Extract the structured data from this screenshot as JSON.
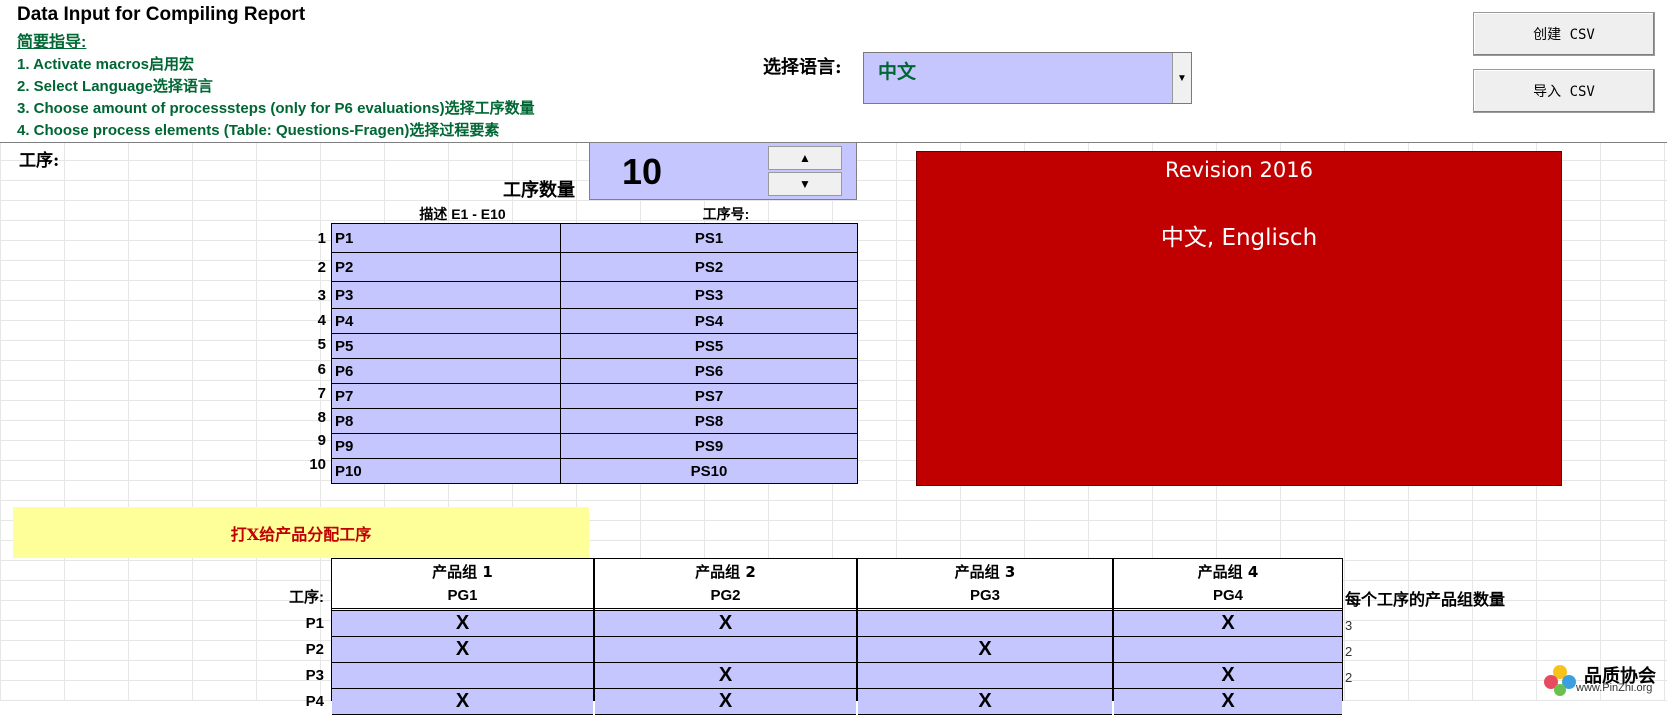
{
  "header": {
    "title": "Data Input for Compiling Report",
    "guide_link": "简要指导:",
    "steps": [
      "1. Activate macros启用宏",
      "2. Select Language选择语言",
      "3. Choose amount of processsteps (only for P6 evaluations)选择工序数量",
      "4. Choose process elements (Table: Questions-Fragen)选择过程要素"
    ]
  },
  "language": {
    "label": "选择语言:",
    "selected": "中文",
    "dropdown_arrow": "▼"
  },
  "buttons": {
    "create_csv": "创建 CSV",
    "import_csv": "导入 CSV"
  },
  "process": {
    "section_label": "工序:",
    "count_label": "工序数量",
    "count_value": "10",
    "spin_up": "▲",
    "spin_down": "▼",
    "col_desc": "描述 E1 - E10",
    "col_no": "工序号:",
    "rows": [
      {
        "num": "1",
        "desc": "P1",
        "no": "PS1"
      },
      {
        "num": "2",
        "desc": "P2",
        "no": "PS2"
      },
      {
        "num": "3",
        "desc": "P3",
        "no": "PS3"
      },
      {
        "num": "4",
        "desc": "P4",
        "no": "PS4"
      },
      {
        "num": "5",
        "desc": "P5",
        "no": "PS5"
      },
      {
        "num": "6",
        "desc": "P6",
        "no": "PS6"
      },
      {
        "num": "7",
        "desc": "P7",
        "no": "PS7"
      },
      {
        "num": "8",
        "desc": "P8",
        "no": "PS8"
      },
      {
        "num": "9",
        "desc": "P9",
        "no": "PS9"
      },
      {
        "num": "10",
        "desc": "P10",
        "no": "PS10"
      }
    ]
  },
  "revision": {
    "line1": "Revision 2016",
    "line2": "中文, Englisch"
  },
  "assign": {
    "banner": "打X给产品分配工序",
    "row_header": "工序:",
    "count_header": "每个工序的产品组数量",
    "groups": [
      {
        "title": "产品组 1",
        "code": "PG1"
      },
      {
        "title": "产品组 2",
        "code": "PG2"
      },
      {
        "title": "产品组 3",
        "code": "PG3"
      },
      {
        "title": "产品组 4",
        "code": "PG4"
      }
    ],
    "rows": [
      {
        "label": "P1",
        "marks": [
          "X",
          "X",
          "",
          "X"
        ],
        "count": "3"
      },
      {
        "label": "P2",
        "marks": [
          "X",
          "",
          "X",
          ""
        ],
        "count": "2"
      },
      {
        "label": "P3",
        "marks": [
          "",
          "X",
          "",
          "X"
        ],
        "count": "2"
      },
      {
        "label": "P4",
        "marks": [
          "X",
          "X",
          "X",
          "X"
        ],
        "count": ""
      }
    ]
  },
  "logo": {
    "name": "品质协会",
    "url": "www.PinZhi.org"
  }
}
